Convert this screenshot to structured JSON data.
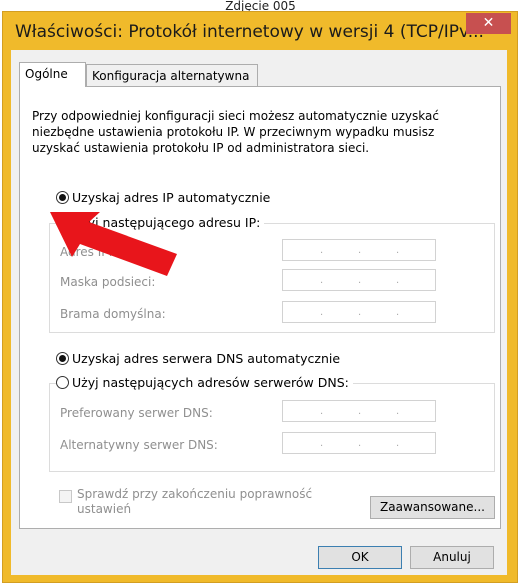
{
  "caption": "Zdjęcie 005",
  "window": {
    "title": "Właściwości: Protokół internetowy w wersji 4 (TCP/IPv...",
    "close_label": "✕"
  },
  "tabs": [
    {
      "label": "Ogólne",
      "active": true
    },
    {
      "label": "Konfiguracja alternatywna",
      "active": false
    }
  ],
  "description": "Przy odpowiedniej konfiguracji sieci możesz automatycznie uzyskać niezbędne ustawienia protokołu IP. W przeciwnym wypadku musisz uzyskać ustawienia protokołu IP od administratora sieci.",
  "ip": {
    "auto_label": "Uzyskaj adres IP automatycznie",
    "auto_selected": true,
    "manual_label": "Użyj następującego adresu IP:",
    "fields": [
      {
        "label": "Adres IP:"
      },
      {
        "label": "Maska podsieci:"
      },
      {
        "label": "Brama domyślna:"
      }
    ]
  },
  "dns": {
    "auto_label": "Uzyskaj adres serwera DNS automatycznie",
    "auto_selected": true,
    "manual_label": "Użyj następujących adresów serwerów DNS:",
    "fields": [
      {
        "label": "Preferowany serwer DNS:"
      },
      {
        "label": "Alternatywny serwer DNS:"
      }
    ]
  },
  "validate": {
    "label_line1": "Sprawdź przy zakończeniu poprawność",
    "label_line2": "ustawień",
    "checked": false
  },
  "buttons": {
    "advanced": "Zaawansowane...",
    "ok": "OK",
    "cancel": "Anuluj"
  },
  "ip_separator": ".",
  "colors": {
    "titlebar": "#f0ba2b",
    "close": "#c75050",
    "arrow": "#e8151b"
  }
}
